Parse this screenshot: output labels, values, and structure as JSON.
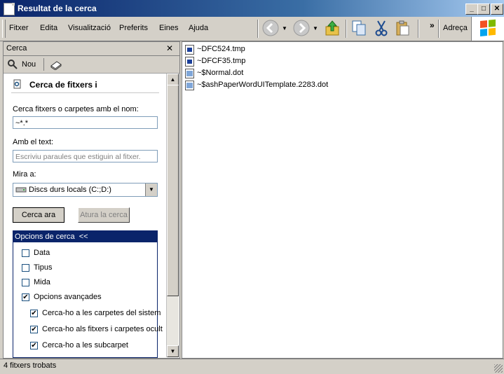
{
  "window": {
    "title": "Resultat de la cerca"
  },
  "menu": [
    "Fitxer",
    "Edita",
    "Visualització",
    "Preferits",
    "Eines",
    "Ajuda"
  ],
  "toolbar": {
    "more": "»",
    "address": "Adreça"
  },
  "search_pane": {
    "title": "Cerca",
    "close": "✕",
    "new_label": "Nou",
    "heading": "Cerca de fitxers i",
    "name_label": "Cerca fitxers o carpetes amb el nom:",
    "name_value": "~*.*",
    "text_label": "Amb el text:",
    "text_placeholder": "Escriviu paraules que estiguin al fitxer.",
    "lookin_label": "Mira a:",
    "lookin_value": "Discs durs locals (C:;D:)",
    "search_button": "Cerca ara",
    "stop_button": "Atura la cerca",
    "options_header": "Opcions de cerca  <<",
    "options": [
      {
        "label": "Data",
        "checked": false
      },
      {
        "label": "Tipus",
        "checked": false
      },
      {
        "label": "Mida",
        "checked": false
      },
      {
        "label": "Opcions avançades",
        "checked": true
      }
    ],
    "advanced": [
      {
        "label": "Cerca-ho a les carpetes del sistem",
        "checked": true
      },
      {
        "label": "Cerca-ho als fitxers i carpetes ocult",
        "checked": true
      },
      {
        "label": "Cerca-ho a les subcarpet",
        "checked": true
      }
    ]
  },
  "files": [
    {
      "name": "~DFC524.tmp",
      "icon": "tmp-file-icon"
    },
    {
      "name": "~DFCF35.tmp",
      "icon": "tmp-file-icon"
    },
    {
      "name": "~$Normal.dot",
      "icon": "word-template-icon"
    },
    {
      "name": "~$ashPaperWordUITemplate.2283.dot",
      "icon": "word-template-icon"
    }
  ],
  "status": {
    "text": "4 fitxers trobats"
  },
  "colors": {
    "title_blue": "#0a246a",
    "selection_blue": "#0a246a",
    "chrome": "#d4d0c8"
  }
}
